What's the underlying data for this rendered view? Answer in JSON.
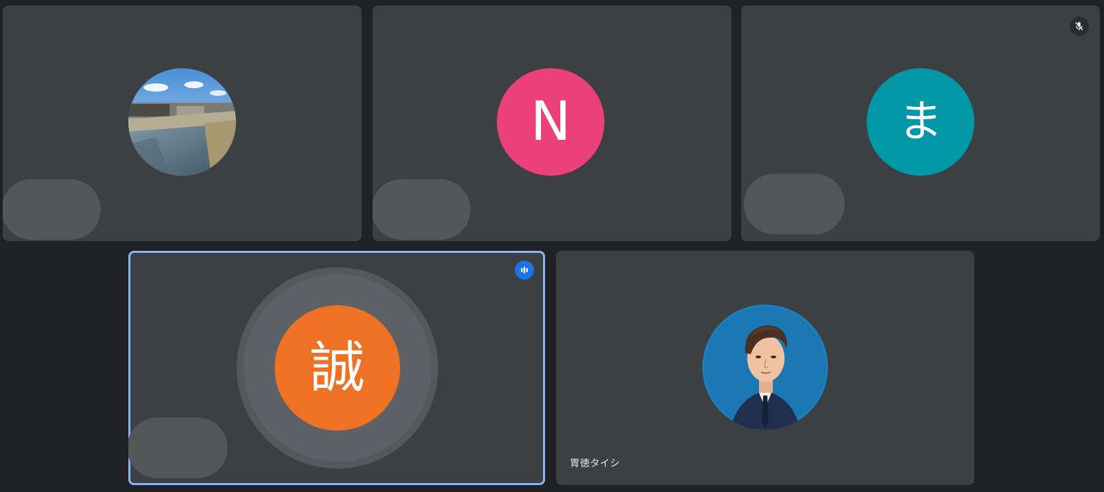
{
  "participants": [
    {
      "id": "p1",
      "avatar": "photo-river",
      "name": "",
      "muted": false,
      "speaking": false
    },
    {
      "id": "p2",
      "avatar": "initial",
      "initial": "N",
      "avatar_color": "#ec407a",
      "name": "",
      "muted": false,
      "speaking": false
    },
    {
      "id": "p3",
      "avatar": "initial",
      "initial": "ま",
      "avatar_color": "#0097a7",
      "name": "",
      "muted": true,
      "speaking": false
    },
    {
      "id": "p4",
      "avatar": "initial",
      "initial": "誠",
      "avatar_color": "#ef7123",
      "name": "",
      "muted": false,
      "speaking": true
    },
    {
      "id": "p5",
      "avatar": "photo-man-illustration",
      "name": "胃徳タイシ",
      "muted": false,
      "speaking": false
    }
  ],
  "icons": {
    "muted": "mic-off-icon",
    "speaking": "audio-level-icon"
  },
  "colors": {
    "background": "#202124",
    "tile": "#3c4043",
    "active_outline": "#8ab4f8",
    "speaking_badge": "#1a73e8"
  }
}
